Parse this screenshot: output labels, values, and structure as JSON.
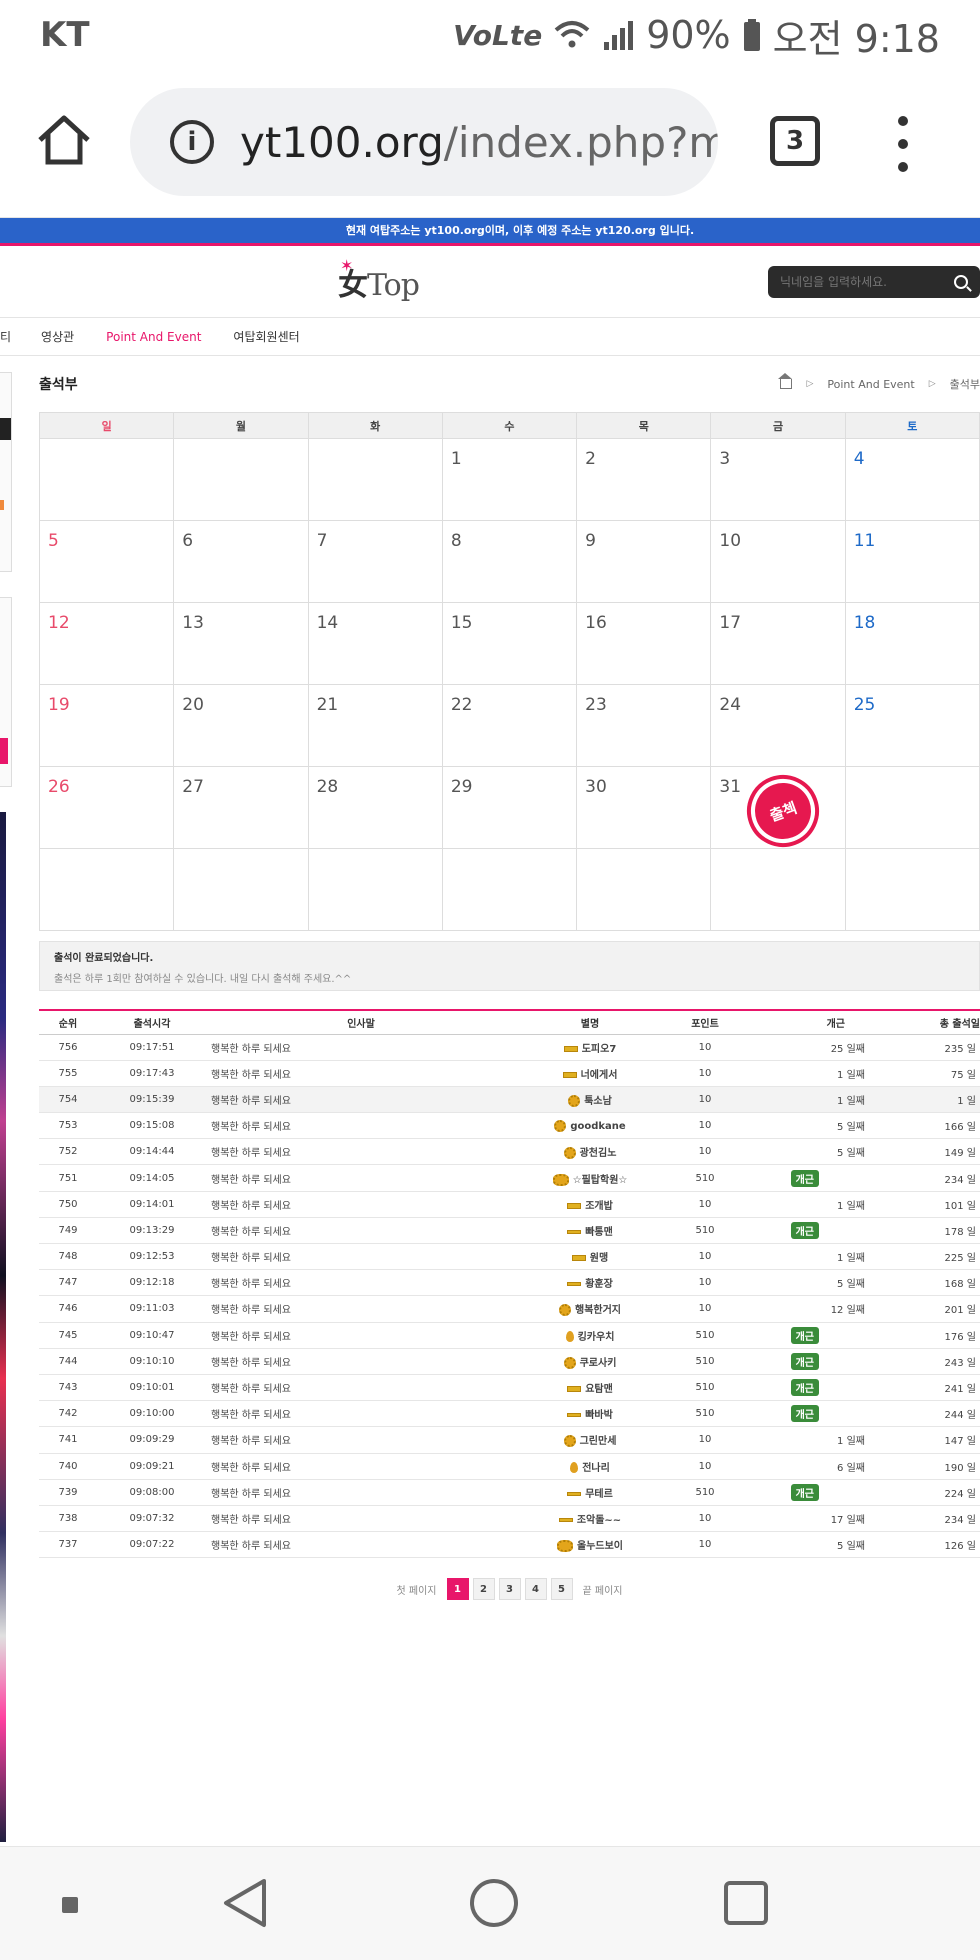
{
  "status_bar": {
    "carrier": "KT",
    "network": "VoLte",
    "battery": "90%",
    "time": "오전 9:18"
  },
  "browser": {
    "url_host": "yt100.org",
    "url_path": "/index.php?m",
    "tab_count": "3"
  },
  "notice": "현재 여탑주소는 yt100.org이며, 이후 예정 주소는 yt120.org 입니다.",
  "header": {
    "logo_char": "女",
    "logo_text": "Top",
    "search_placeholder": "닉네임을 입력하세요."
  },
  "nav": {
    "cut_item": "티",
    "items": [
      "영상관",
      "Point And Event",
      "여탑회원센터"
    ],
    "active_index": 1
  },
  "page": {
    "title": "출석부",
    "breadcrumb": [
      "Point And Event",
      "출석부"
    ]
  },
  "calendar": {
    "weekdays": [
      "일",
      "월",
      "화",
      "수",
      "목",
      "금",
      "토"
    ],
    "weeks": [
      [
        "",
        "",
        "",
        "1",
        "2",
        "3",
        "4"
      ],
      [
        "5",
        "6",
        "7",
        "8",
        "9",
        "10",
        "11"
      ],
      [
        "12",
        "13",
        "14",
        "15",
        "16",
        "17",
        "18"
      ],
      [
        "19",
        "20",
        "21",
        "22",
        "23",
        "24",
        "25"
      ],
      [
        "26",
        "27",
        "28",
        "29",
        "30",
        "31",
        ""
      ],
      [
        "",
        "",
        "",
        "",
        "",
        "",
        ""
      ]
    ],
    "stamp_text": "출첵"
  },
  "completion": {
    "title": "출석이 완료되었습니다.",
    "subtitle": "출석은 하루 1회만 참여하실 수 있습니다. 내일 다시 출석해 주세요.^^"
  },
  "attendance": {
    "headers": [
      "순위",
      "출석시각",
      "인사말",
      "별명",
      "포인트",
      "개근",
      "총 출석일"
    ],
    "rows": [
      {
        "rank": "756",
        "time": "09:17:51",
        "greeting": "행복한 하루 되세요",
        "nick": "도피오7",
        "icon": "bar",
        "point": "10",
        "streak": "25 일째",
        "total": "235 일"
      },
      {
        "rank": "755",
        "time": "09:17:43",
        "greeting": "행복한 하루 되세요",
        "nick": "너에게서",
        "icon": "bar",
        "point": "10",
        "streak": "1 일째",
        "total": "75 일"
      },
      {
        "rank": "754",
        "time": "09:15:39",
        "greeting": "행복한 하루 되세요",
        "nick": "툭소남",
        "icon": "sun",
        "point": "10",
        "streak": "1 일째",
        "total": "1 일"
      },
      {
        "rank": "753",
        "time": "09:15:08",
        "greeting": "행복한 하루 되세요",
        "nick": "goodkane",
        "icon": "sun",
        "point": "10",
        "streak": "5 일째",
        "total": "166 일"
      },
      {
        "rank": "752",
        "time": "09:14:44",
        "greeting": "행복한 하루 되세요",
        "nick": "광천김노",
        "icon": "sun",
        "point": "10",
        "streak": "5 일째",
        "total": "149 일"
      },
      {
        "rank": "751",
        "time": "09:14:05",
        "greeting": "행복한 하루 되세요",
        "nick": "☆필탑학원☆",
        "icon": "sunbig",
        "point": "510",
        "streak": "개근",
        "total": "234 일"
      },
      {
        "rank": "750",
        "time": "09:14:01",
        "greeting": "행복한 하루 되세요",
        "nick": "조개밥",
        "icon": "bar",
        "point": "10",
        "streak": "1 일째",
        "total": "101 일"
      },
      {
        "rank": "749",
        "time": "09:13:29",
        "greeting": "행복한 하루 되세요",
        "nick": "빠통맨",
        "icon": "thin",
        "point": "510",
        "streak": "개근",
        "total": "178 일"
      },
      {
        "rank": "748",
        "time": "09:12:53",
        "greeting": "행복한 하루 되세요",
        "nick": "원맹",
        "icon": "bar",
        "point": "10",
        "streak": "1 일째",
        "total": "225 일"
      },
      {
        "rank": "747",
        "time": "09:12:18",
        "greeting": "행복한 하루 되세요",
        "nick": "황훈장",
        "icon": "thin",
        "point": "10",
        "streak": "5 일째",
        "total": "168 일"
      },
      {
        "rank": "746",
        "time": "09:11:03",
        "greeting": "행복한 하루 되세요",
        "nick": "행복한거지",
        "icon": "sun",
        "point": "10",
        "streak": "12 일째",
        "total": "201 일"
      },
      {
        "rank": "745",
        "time": "09:10:47",
        "greeting": "행복한 하루 되세요",
        "nick": "킹카우치",
        "icon": "drop",
        "point": "510",
        "streak": "개근",
        "total": "176 일"
      },
      {
        "rank": "744",
        "time": "09:10:10",
        "greeting": "행복한 하루 되세요",
        "nick": "쿠로사키",
        "icon": "sun",
        "point": "510",
        "streak": "개근",
        "total": "243 일"
      },
      {
        "rank": "743",
        "time": "09:10:01",
        "greeting": "행복한 하루 되세요",
        "nick": "요탐맨",
        "icon": "bar",
        "point": "510",
        "streak": "개근",
        "total": "241 일"
      },
      {
        "rank": "742",
        "time": "09:10:00",
        "greeting": "행복한 하루 되세요",
        "nick": "빠바박",
        "icon": "thin",
        "point": "510",
        "streak": "개근",
        "total": "244 일"
      },
      {
        "rank": "741",
        "time": "09:09:29",
        "greeting": "행복한 하루 되세요",
        "nick": "그린만세",
        "icon": "sun",
        "point": "10",
        "streak": "1 일째",
        "total": "147 일"
      },
      {
        "rank": "740",
        "time": "09:09:21",
        "greeting": "행복한 하루 되세요",
        "nick": "전나리",
        "icon": "drop",
        "point": "10",
        "streak": "6 일째",
        "total": "190 일"
      },
      {
        "rank": "739",
        "time": "09:08:00",
        "greeting": "행복한 하루 되세요",
        "nick": "무테르",
        "icon": "thin",
        "point": "510",
        "streak": "개근",
        "total": "224 일"
      },
      {
        "rank": "738",
        "time": "09:07:32",
        "greeting": "행복한 하루 되세요",
        "nick": "조악돌~~",
        "icon": "thin",
        "point": "10",
        "streak": "17 일째",
        "total": "234 일"
      },
      {
        "rank": "737",
        "time": "09:07:22",
        "greeting": "행복한 하루 되세요",
        "nick": "올누드보이",
        "icon": "sunbig",
        "point": "10",
        "streak": "5 일째",
        "total": "126 일"
      }
    ]
  },
  "pagination": {
    "first": "첫 페이지",
    "pages": [
      "1",
      "2",
      "3",
      "4",
      "5"
    ],
    "current": "1",
    "last": "끝 페이지"
  },
  "colors": {
    "accent": "#e8166a",
    "banner_blue": "#2a63c9",
    "sunday": "#e84a6a",
    "saturday": "#1e6ac8",
    "badge_green": "#3a8c3a",
    "stamp_red": "#e6184f"
  }
}
